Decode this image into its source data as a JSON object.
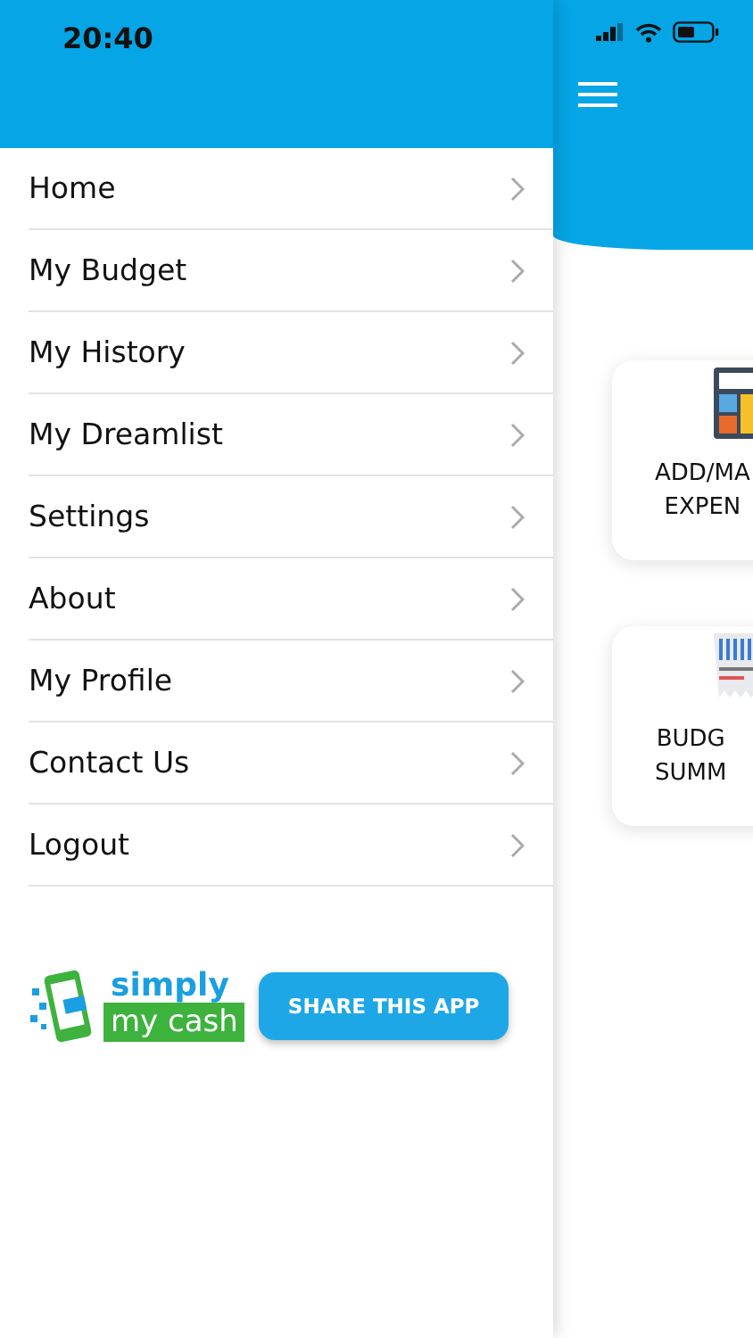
{
  "status_bar": {
    "time": "20:40"
  },
  "menu": [
    {
      "label": "Home"
    },
    {
      "label": "My Budget"
    },
    {
      "label": "My History"
    },
    {
      "label": "My Dreamlist"
    },
    {
      "label": "Settings"
    },
    {
      "label": "About"
    },
    {
      "label": "My Profile"
    },
    {
      "label": "Contact Us"
    },
    {
      "label": "Logout"
    }
  ],
  "logo": {
    "line_1": "simply",
    "line_2": "my cash"
  },
  "share_button": "SHARE THIS APP",
  "cards": [
    {
      "kind": "calculator",
      "lines": [
        "ADD/MA",
        "EXPEN"
      ]
    },
    {
      "kind": "receipt",
      "lines": [
        "BUDG",
        "SUMM"
      ]
    }
  ]
}
